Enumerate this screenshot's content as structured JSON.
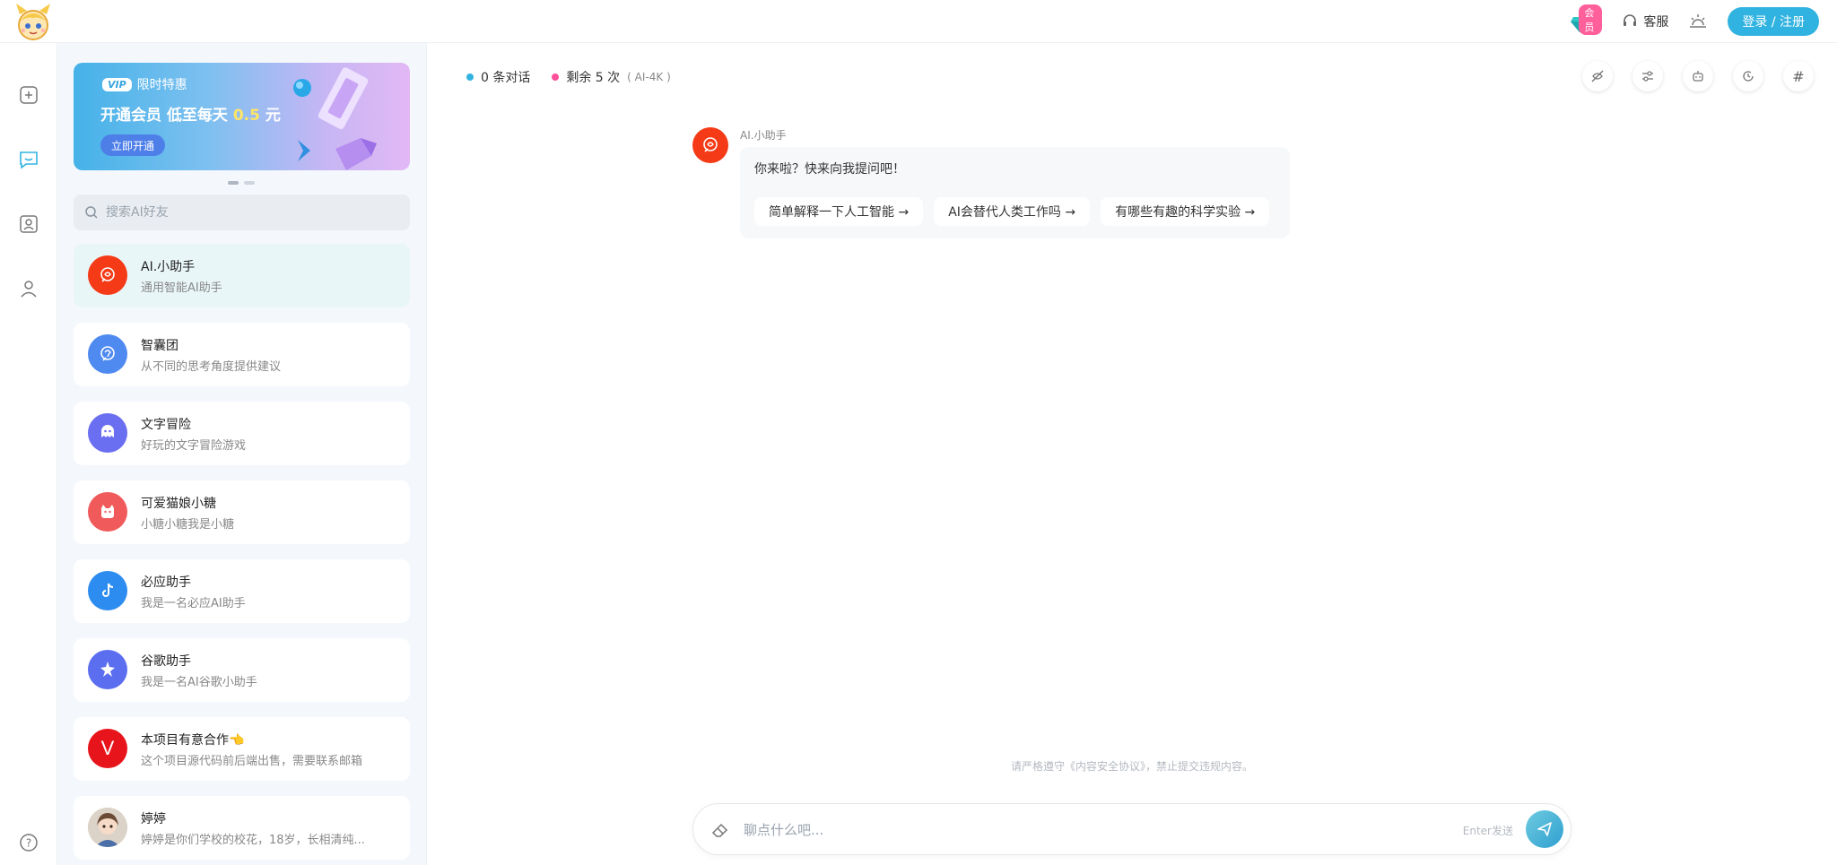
{
  "header": {
    "vip_badge": "会员",
    "support_label": "客服",
    "login_label": "登录 / 注册"
  },
  "banner": {
    "vip_pill": "VIP",
    "tag": "限时特惠",
    "title_prefix": "开通会员 低至每天",
    "price": "0.5",
    "title_suffix": "元",
    "button": "立即开通"
  },
  "search": {
    "placeholder": "搜索AI好友"
  },
  "agents": [
    {
      "name": "AI.小助手",
      "desc": "通用智能AI助手",
      "color": "#f43a16",
      "icon": "ai-assistant-icon"
    },
    {
      "name": "智囊团",
      "desc": "从不同的思考角度提供建议",
      "color": "#4e8af0",
      "icon": "brain-icon"
    },
    {
      "name": "文字冒险",
      "desc": "好玩的文字冒险游戏",
      "color": "#6a6ef0",
      "icon": "game-icon"
    },
    {
      "name": "可爱猫娘小糖",
      "desc": "小糖小糖我是小糖",
      "color": "#f05a5a",
      "icon": "cat-icon"
    },
    {
      "name": "必应助手",
      "desc": "我是一名必应AI助手",
      "color": "#2d8cf0",
      "icon": "tiktok-icon"
    },
    {
      "name": "谷歌助手",
      "desc": "我是一名AI谷歌小助手",
      "color": "#5b6ef0",
      "icon": "sparkle-icon"
    },
    {
      "name": "本项目有意合作👈",
      "desc": "这个项目源代码前后端出售，需要联系邮箱",
      "color": "#e8141c",
      "icon": "v-logo-icon",
      "letter": "V"
    },
    {
      "name": "婷婷",
      "desc": "婷婷是你们学校的校花，18岁，长相清纯...",
      "color": "#c9b7a5",
      "icon": "portrait-avatar-icon"
    }
  ],
  "stats": {
    "conversations": "0 条对话",
    "remaining": "剩余 5 次",
    "model": "( AI-4K )",
    "conv_color": "#30b3e0",
    "remain_color": "#ff4f9a"
  },
  "message": {
    "sender": "AI.小助手",
    "text": "你来啦？快来向我提问吧！",
    "suggestions": [
      "简单解释一下人工智能 →",
      "AI会替代人类工作吗 →",
      "有哪些有趣的科学实验 →"
    ]
  },
  "notice": "请严格遵守《内容安全协议》，禁止提交违规内容。",
  "composer": {
    "placeholder": "聊点什么吧...",
    "hint": "Enter发送"
  },
  "tools": [
    "hide-icon",
    "settings-sliders-icon",
    "robot-icon",
    "history-icon",
    "hashtag-icon"
  ],
  "tool_hash": "#"
}
